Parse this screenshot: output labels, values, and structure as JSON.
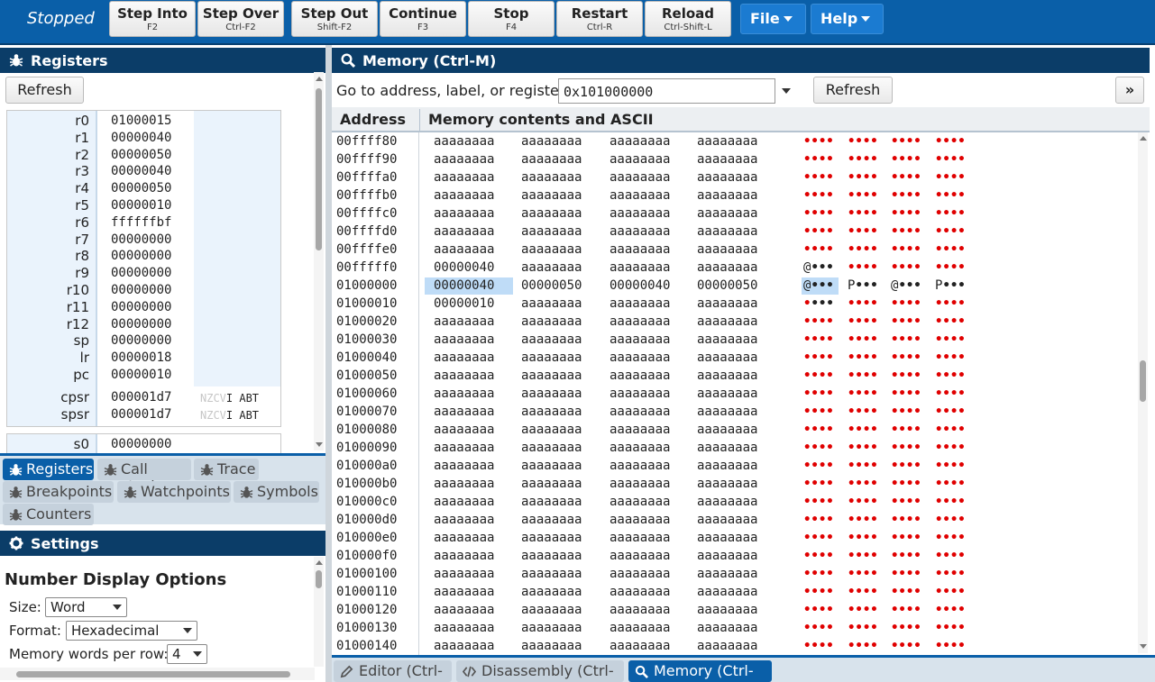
{
  "toolbar": {
    "status": "Stopped",
    "buttons": [
      {
        "label": "Step Into",
        "key": "F2"
      },
      {
        "label": "Step Over",
        "key": "Ctrl-F2"
      },
      {
        "label": "Step Out",
        "key": "Shift-F2"
      },
      {
        "label": "Continue",
        "key": "F3"
      },
      {
        "label": "Stop",
        "key": "F4"
      },
      {
        "label": "Restart",
        "key": "Ctrl-R"
      },
      {
        "label": "Reload",
        "key": "Ctrl-Shift-L"
      }
    ],
    "file_menu": "File",
    "help_menu": "Help"
  },
  "registers_panel": {
    "title": "Registers",
    "refresh": "Refresh",
    "registers": [
      {
        "name": "r0",
        "value": "01000015"
      },
      {
        "name": "r1",
        "value": "00000040"
      },
      {
        "name": "r2",
        "value": "00000050"
      },
      {
        "name": "r3",
        "value": "00000040"
      },
      {
        "name": "r4",
        "value": "00000050"
      },
      {
        "name": "r5",
        "value": "00000010"
      },
      {
        "name": "r6",
        "value": "ffffffbf"
      },
      {
        "name": "r7",
        "value": "00000000"
      },
      {
        "name": "r8",
        "value": "00000000"
      },
      {
        "name": "r9",
        "value": "00000000"
      },
      {
        "name": "r10",
        "value": "00000000"
      },
      {
        "name": "r11",
        "value": "00000000"
      },
      {
        "name": "r12",
        "value": "00000000"
      },
      {
        "name": "sp",
        "value": "00000000"
      },
      {
        "name": "lr",
        "value": "00000018"
      },
      {
        "name": "pc",
        "value": "00000010"
      }
    ],
    "status_registers": [
      {
        "name": "cpsr",
        "value": "000001d7",
        "flags_dim": "NZCV",
        "flags": "I ABT"
      },
      {
        "name": "spsr",
        "value": "000001d7",
        "flags_dim": "NZCV",
        "flags": "I ABT"
      }
    ],
    "s0": {
      "name": "s0",
      "value": "00000000"
    }
  },
  "left_tabs": [
    {
      "label": "Registers",
      "active": true
    },
    {
      "label": "Call stack"
    },
    {
      "label": "Trace"
    },
    {
      "label": "Breakpoints"
    },
    {
      "label": "Watchpoints"
    },
    {
      "label": "Symbols"
    },
    {
      "label": "Counters"
    }
  ],
  "settings": {
    "title": "Settings",
    "section": "Number Display Options",
    "size_label": "Size:",
    "size_value": "Word",
    "format_label": "Format:",
    "format_value": "Hexadecimal",
    "words_label": "Memory words per row:",
    "words_value": "4"
  },
  "memory_panel": {
    "title": "Memory (Ctrl-M)",
    "goto_label": "Go to address, label, or register:",
    "goto_value": "0x101000000",
    "refresh": "Refresh",
    "expand": "»",
    "col_address": "Address",
    "col_contents": "Memory contents and ASCII",
    "rows": [
      {
        "addr": "00ffff80",
        "w": [
          "aaaaaaaa",
          "aaaaaaaa",
          "aaaaaaaa",
          "aaaaaaaa"
        ],
        "a": [
          "••••",
          "••••",
          "••••",
          "••••"
        ]
      },
      {
        "addr": "00ffff90",
        "w": [
          "aaaaaaaa",
          "aaaaaaaa",
          "aaaaaaaa",
          "aaaaaaaa"
        ],
        "a": [
          "••••",
          "••••",
          "••••",
          "••••"
        ]
      },
      {
        "addr": "00ffffa0",
        "w": [
          "aaaaaaaa",
          "aaaaaaaa",
          "aaaaaaaa",
          "aaaaaaaa"
        ],
        "a": [
          "••••",
          "••••",
          "••••",
          "••••"
        ]
      },
      {
        "addr": "00ffffb0",
        "w": [
          "aaaaaaaa",
          "aaaaaaaa",
          "aaaaaaaa",
          "aaaaaaaa"
        ],
        "a": [
          "••••",
          "••••",
          "••••",
          "••••"
        ]
      },
      {
        "addr": "00ffffc0",
        "w": [
          "aaaaaaaa",
          "aaaaaaaa",
          "aaaaaaaa",
          "aaaaaaaa"
        ],
        "a": [
          "••••",
          "••••",
          "••••",
          "••••"
        ]
      },
      {
        "addr": "00ffffd0",
        "w": [
          "aaaaaaaa",
          "aaaaaaaa",
          "aaaaaaaa",
          "aaaaaaaa"
        ],
        "a": [
          "••••",
          "••••",
          "••••",
          "••••"
        ]
      },
      {
        "addr": "00ffffe0",
        "w": [
          "aaaaaaaa",
          "aaaaaaaa",
          "aaaaaaaa",
          "aaaaaaaa"
        ],
        "a": [
          "••••",
          "••••",
          "••••",
          "••••"
        ]
      },
      {
        "addr": "00fffff0",
        "w": [
          "00000040",
          "aaaaaaaa",
          "aaaaaaaa",
          "aaaaaaaa"
        ],
        "a": [
          "@•••",
          "••••",
          "••••",
          "••••"
        ],
        "black": [
          0
        ]
      },
      {
        "addr": "01000000",
        "w": [
          "00000040",
          "00000050",
          "00000040",
          "00000050"
        ],
        "a": [
          "@•••",
          "P•••",
          "@•••",
          "P•••"
        ],
        "black": [
          0,
          1,
          2,
          3
        ],
        "highlight": true
      },
      {
        "addr": "01000010",
        "w": [
          "00000010",
          "aaaaaaaa",
          "aaaaaaaa",
          "aaaaaaaa"
        ],
        "a": [
          "••••",
          "••••",
          "••••",
          "••••"
        ],
        "black": [
          0
        ]
      },
      {
        "addr": "01000020",
        "w": [
          "aaaaaaaa",
          "aaaaaaaa",
          "aaaaaaaa",
          "aaaaaaaa"
        ],
        "a": [
          "••••",
          "••••",
          "••••",
          "••••"
        ]
      },
      {
        "addr": "01000030",
        "w": [
          "aaaaaaaa",
          "aaaaaaaa",
          "aaaaaaaa",
          "aaaaaaaa"
        ],
        "a": [
          "••••",
          "••••",
          "••••",
          "••••"
        ]
      },
      {
        "addr": "01000040",
        "w": [
          "aaaaaaaa",
          "aaaaaaaa",
          "aaaaaaaa",
          "aaaaaaaa"
        ],
        "a": [
          "••••",
          "••••",
          "••••",
          "••••"
        ]
      },
      {
        "addr": "01000050",
        "w": [
          "aaaaaaaa",
          "aaaaaaaa",
          "aaaaaaaa",
          "aaaaaaaa"
        ],
        "a": [
          "••••",
          "••••",
          "••••",
          "••••"
        ]
      },
      {
        "addr": "01000060",
        "w": [
          "aaaaaaaa",
          "aaaaaaaa",
          "aaaaaaaa",
          "aaaaaaaa"
        ],
        "a": [
          "••••",
          "••••",
          "••••",
          "••••"
        ]
      },
      {
        "addr": "01000070",
        "w": [
          "aaaaaaaa",
          "aaaaaaaa",
          "aaaaaaaa",
          "aaaaaaaa"
        ],
        "a": [
          "••••",
          "••••",
          "••••",
          "••••"
        ]
      },
      {
        "addr": "01000080",
        "w": [
          "aaaaaaaa",
          "aaaaaaaa",
          "aaaaaaaa",
          "aaaaaaaa"
        ],
        "a": [
          "••••",
          "••••",
          "••••",
          "••••"
        ]
      },
      {
        "addr": "01000090",
        "w": [
          "aaaaaaaa",
          "aaaaaaaa",
          "aaaaaaaa",
          "aaaaaaaa"
        ],
        "a": [
          "••••",
          "••••",
          "••••",
          "••••"
        ]
      },
      {
        "addr": "010000a0",
        "w": [
          "aaaaaaaa",
          "aaaaaaaa",
          "aaaaaaaa",
          "aaaaaaaa"
        ],
        "a": [
          "••••",
          "••••",
          "••••",
          "••••"
        ]
      },
      {
        "addr": "010000b0",
        "w": [
          "aaaaaaaa",
          "aaaaaaaa",
          "aaaaaaaa",
          "aaaaaaaa"
        ],
        "a": [
          "••••",
          "••••",
          "••••",
          "••••"
        ]
      },
      {
        "addr": "010000c0",
        "w": [
          "aaaaaaaa",
          "aaaaaaaa",
          "aaaaaaaa",
          "aaaaaaaa"
        ],
        "a": [
          "••••",
          "••••",
          "••••",
          "••••"
        ]
      },
      {
        "addr": "010000d0",
        "w": [
          "aaaaaaaa",
          "aaaaaaaa",
          "aaaaaaaa",
          "aaaaaaaa"
        ],
        "a": [
          "••••",
          "••••",
          "••••",
          "••••"
        ]
      },
      {
        "addr": "010000e0",
        "w": [
          "aaaaaaaa",
          "aaaaaaaa",
          "aaaaaaaa",
          "aaaaaaaa"
        ],
        "a": [
          "••••",
          "••••",
          "••••",
          "••••"
        ]
      },
      {
        "addr": "010000f0",
        "w": [
          "aaaaaaaa",
          "aaaaaaaa",
          "aaaaaaaa",
          "aaaaaaaa"
        ],
        "a": [
          "••••",
          "••••",
          "••••",
          "••••"
        ]
      },
      {
        "addr": "01000100",
        "w": [
          "aaaaaaaa",
          "aaaaaaaa",
          "aaaaaaaa",
          "aaaaaaaa"
        ],
        "a": [
          "••••",
          "••••",
          "••••",
          "••••"
        ]
      },
      {
        "addr": "01000110",
        "w": [
          "aaaaaaaa",
          "aaaaaaaa",
          "aaaaaaaa",
          "aaaaaaaa"
        ],
        "a": [
          "••••",
          "••••",
          "••••",
          "••••"
        ]
      },
      {
        "addr": "01000120",
        "w": [
          "aaaaaaaa",
          "aaaaaaaa",
          "aaaaaaaa",
          "aaaaaaaa"
        ],
        "a": [
          "••••",
          "••••",
          "••••",
          "••••"
        ]
      },
      {
        "addr": "01000130",
        "w": [
          "aaaaaaaa",
          "aaaaaaaa",
          "aaaaaaaa",
          "aaaaaaaa"
        ],
        "a": [
          "••••",
          "••••",
          "••••",
          "••••"
        ]
      },
      {
        "addr": "01000140",
        "w": [
          "aaaaaaaa",
          "aaaaaaaa",
          "aaaaaaaa",
          "aaaaaaaa"
        ],
        "a": [
          "••••",
          "••••",
          "••••",
          "••••"
        ]
      }
    ]
  },
  "right_tabs": [
    {
      "label": "Editor (Ctrl-E)"
    },
    {
      "label": "Disassembly (Ctrl-D)"
    },
    {
      "label": "Memory (Ctrl-M)",
      "active": true
    }
  ],
  "colors": {
    "toolbar": "#0a5fa8",
    "panel_header": "#0b3d68",
    "unknown_byte": "#e00000",
    "highlight": "#bfdcf7"
  },
  "icons": {
    "registers_header": "bug-icon",
    "settings_header": "gear-icon",
    "memory_header": "search-icon"
  }
}
